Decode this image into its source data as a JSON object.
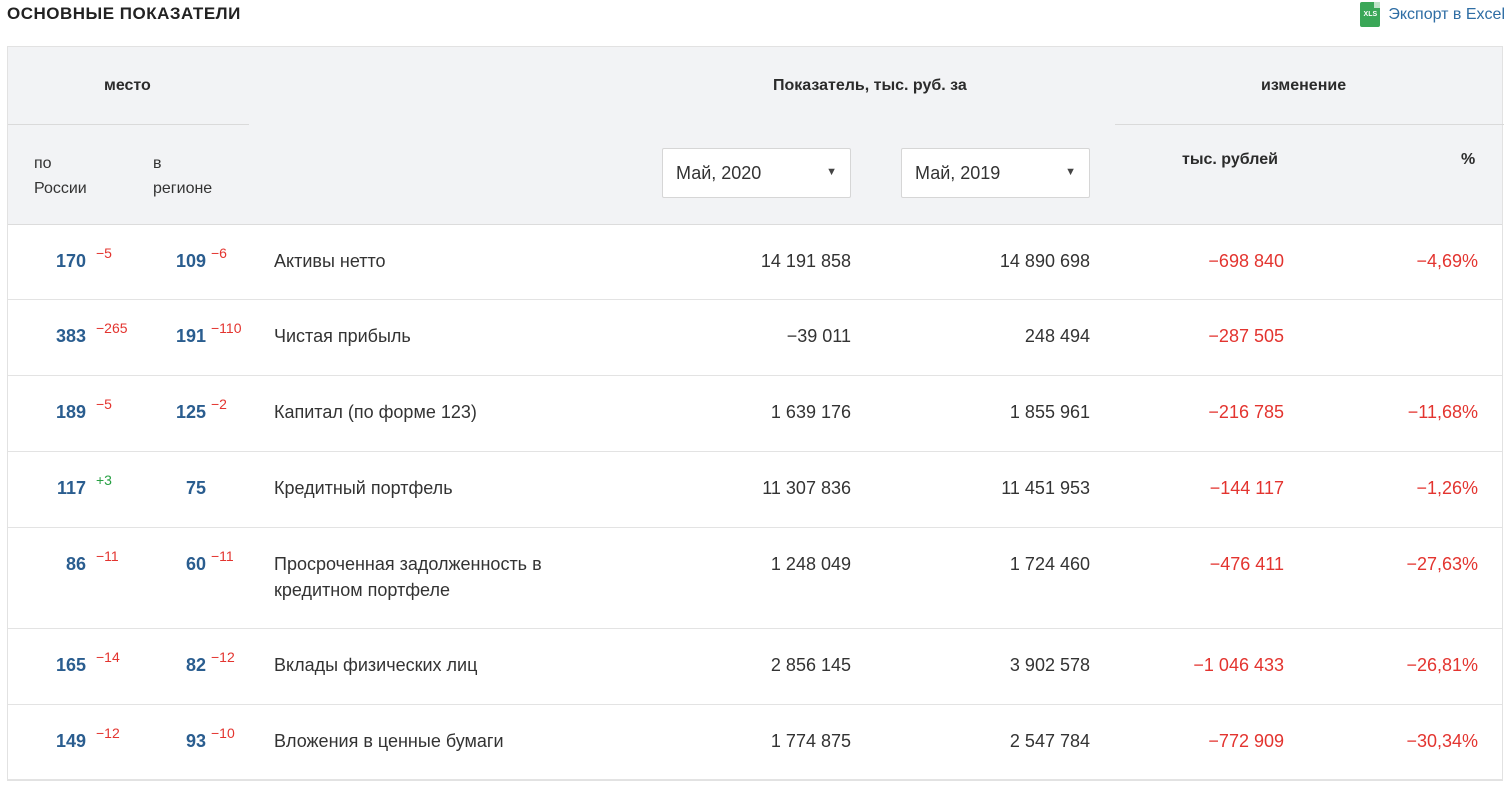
{
  "page_title": "ОСНОВНЫЕ ПОКАЗАТЕЛИ",
  "export": {
    "label": "Экспорт в Excel",
    "icon": "xls-file-icon",
    "icon_text": "XLS"
  },
  "header": {
    "place": "место",
    "indicator": "Показатель, тыс. руб. за",
    "change": "изменение",
    "by_russia": "по\nРоссии",
    "in_region": "в\nрегионе",
    "period1": "Май, 2020",
    "period2": "Май, 2019",
    "thousand_rub": "тыс. рублей",
    "percent": "%"
  },
  "rows": [
    {
      "rank_russia": "170",
      "delta_russia": "−5",
      "rank_region": "109",
      "delta_region": "−6",
      "name": "Активы нетто",
      "value1": "14 191 858",
      "value2": "14 890 698",
      "change_abs": "−698 840",
      "change_pct": "−4,69%"
    },
    {
      "rank_russia": "383",
      "delta_russia": "−265",
      "rank_region": "191",
      "delta_region": "−110",
      "name": "Чистая прибыль",
      "value1": "−39 011",
      "value2": "248 494",
      "change_abs": "−287 505",
      "change_pct": ""
    },
    {
      "rank_russia": "189",
      "delta_russia": "−5",
      "rank_region": "125",
      "delta_region": "−2",
      "name": "Капитал (по форме 123)",
      "value1": "1 639 176",
      "value2": "1 855 961",
      "change_abs": "−216 785",
      "change_pct": "−11,68%"
    },
    {
      "rank_russia": "117",
      "delta_russia": "+3",
      "rank_region": "75",
      "delta_region": "",
      "name": "Кредитный портфель",
      "value1": "11 307 836",
      "value2": "11 451 953",
      "change_abs": "−144 117",
      "change_pct": "−1,26%"
    },
    {
      "rank_russia": "86",
      "delta_russia": "−11",
      "rank_region": "60",
      "delta_region": "−11",
      "name": "Просроченная задолженность в кредитном портфеле",
      "value1": "1 248 049",
      "value2": "1 724 460",
      "change_abs": "−476 411",
      "change_pct": "−27,63%"
    },
    {
      "rank_russia": "165",
      "delta_russia": "−14",
      "rank_region": "82",
      "delta_region": "−12",
      "name": "Вклады физических лиц",
      "value1": "2 856 145",
      "value2": "3 902 578",
      "change_abs": "−1 046 433",
      "change_pct": "−26,81%"
    },
    {
      "rank_russia": "149",
      "delta_russia": "−12",
      "rank_region": "93",
      "delta_region": "−10",
      "name": "Вложения в ценные бумаги",
      "value1": "1 774 875",
      "value2": "2 547 784",
      "change_abs": "−772 909",
      "change_pct": "−30,34%"
    }
  ],
  "colors": {
    "rank": "#2a5d8f",
    "negative": "#e3342f",
    "positive": "#27a043",
    "header_bg": "#f2f3f5",
    "link": "#2e6da4"
  }
}
